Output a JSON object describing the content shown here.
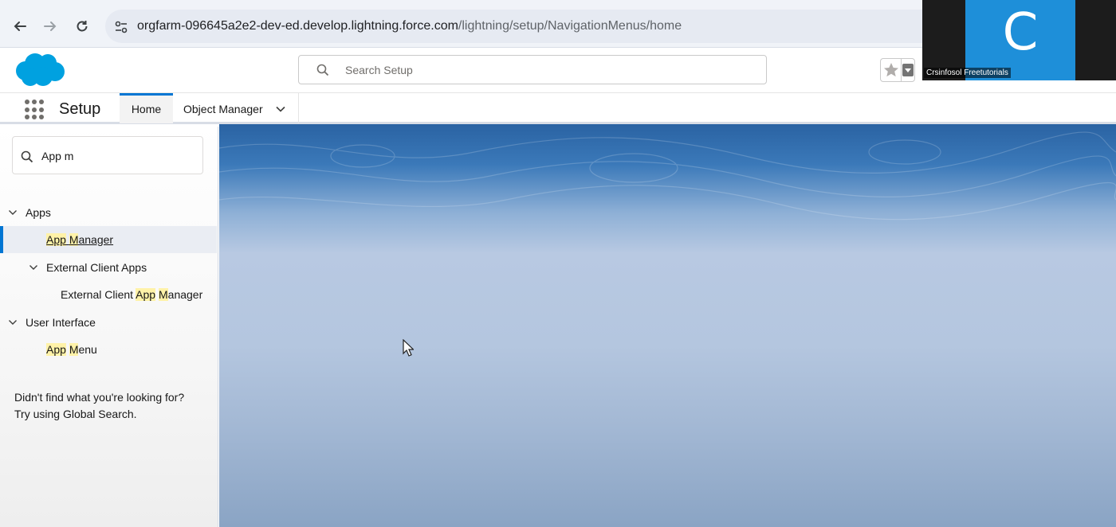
{
  "browser": {
    "url_domain": "orgfarm-096645a2e2-dev-ed.develop.lightning.force.com",
    "url_path": "/lightning/setup/NavigationMenus/home"
  },
  "webcam": {
    "letter": "C",
    "name": "Crsinfosol Freetutorials"
  },
  "header": {
    "search_placeholder": "Search Setup"
  },
  "context_nav": {
    "app_name": "Setup",
    "tabs": [
      {
        "label": "Home"
      },
      {
        "label": "Object Manager"
      }
    ]
  },
  "sidebar": {
    "quick_find_value": "App m",
    "tree": {
      "apps": {
        "label": "Apps",
        "app_manager": {
          "pre": "",
          "hl1": "App",
          "mid": " ",
          "hl2": "M",
          "post": "anager"
        },
        "external_client_apps": {
          "label": "External Client Apps",
          "manager": {
            "pre": "External Client ",
            "hl1": "App",
            "mid": " ",
            "hl2": "M",
            "post": "anager"
          }
        }
      },
      "user_interface": {
        "label": "User Interface",
        "app_menu": {
          "pre": "",
          "hl1": "App",
          "mid": " ",
          "hl2": "M",
          "post": "enu"
        }
      }
    },
    "no_result_line1": "Didn't find what you're looking for?",
    "no_result_line2": "Try using Global Search."
  },
  "colors": {
    "brand": "#00a1e0",
    "accent": "#0176d3",
    "highlight": "#fff2a8"
  }
}
